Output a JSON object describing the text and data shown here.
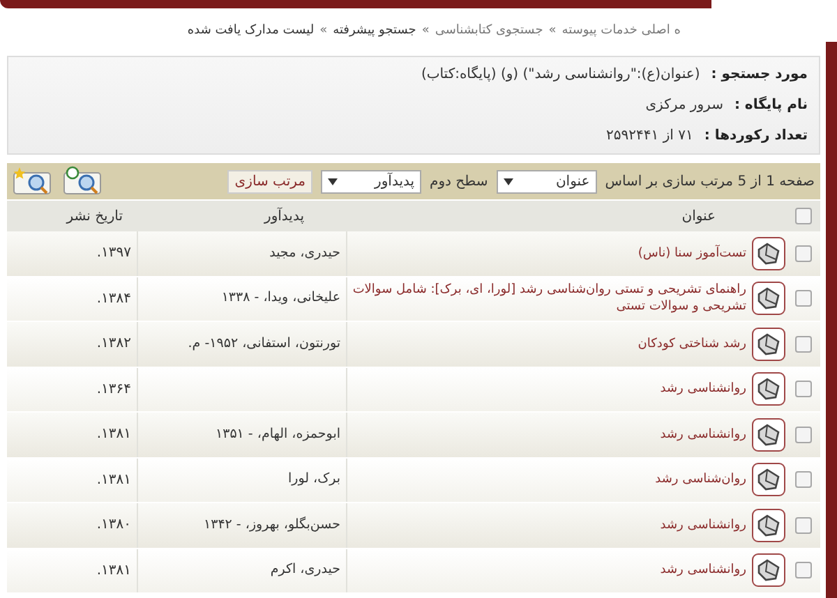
{
  "breadcrumb": [
    {
      "kind": "link",
      "text": "ه اصلی خدمات پیوسته"
    },
    {
      "kind": "separator",
      "text": "»"
    },
    {
      "kind": "link",
      "text": "جستجوی کتابشناسی"
    },
    {
      "kind": "separator",
      "text": "»"
    },
    {
      "kind": "current",
      "text": "جستجو پیشرفته"
    },
    {
      "kind": "separator",
      "text": "»"
    },
    {
      "kind": "current",
      "text": "لیست مدارک یافت شده"
    }
  ],
  "search_info": [
    {
      "label": "مورد جستجو :",
      "value": "(عنوان(ع):\"روانشناسی رشد\") (و) (پایگاه:کتاب)"
    },
    {
      "label": "نام پایگاه :",
      "value": "سرور مرکزی"
    },
    {
      "label": "تعداد رکوردها :",
      "value": "۷۱ از ۲۵۹۲۴۴۱"
    }
  ],
  "toolbar": {
    "page_text": "صفحه 1 از 5 مرتب سازی بر اساس",
    "sort_first": "عنوان",
    "second_level_label": "سطح دوم",
    "sort_second": "پدیدآور",
    "sort_button": "مرتب سازی"
  },
  "table": {
    "columns": [
      "عنوان",
      "پدیدآور",
      "تاریخ نشر"
    ],
    "header_checked": false,
    "rows": [
      {
        "checked": false,
        "title": "تست‌آموز سنا (ناس)",
        "author": "حیدری، مجید",
        "date": "۱۳۹۷."
      },
      {
        "checked": false,
        "title": "راهنمای تشریحی و تستی روان‌شناسی رشد [لورا، ای، برک]: شامل سوالات تشریحی و سوالات تستی",
        "author": "علیخانی، ویدا، - ۱۳۳۸",
        "date": "۱۳۸۴."
      },
      {
        "checked": false,
        "title": "رشد شناختی کودکان",
        "author": "تورنتون، استفانی، ۱۹۵۲- م.",
        "date": "۱۳۸۲."
      },
      {
        "checked": false,
        "title": "روانشناسی رشد",
        "date": "۱۳۶۴."
      },
      {
        "checked": false,
        "title": "روانشناسی رشد",
        "author": "ابوحمزه، الهام، - ۱۳۵۱",
        "date": "۱۳۸۱."
      },
      {
        "checked": false,
        "title": "روان‌شناسی رشد",
        "author": "برک، لورا",
        "date": "۱۳۸۱."
      },
      {
        "checked": false,
        "title": "روانشناسی رشد",
        "author": "حسن‌بگلو، بهروز، - ۱۳۴۲",
        "date": "۱۳۸۰."
      },
      {
        "checked": false,
        "title": "روانشناسی رشد",
        "author": "حیدری، اکرم",
        "date": "۱۳۸۱."
      }
    ]
  }
}
